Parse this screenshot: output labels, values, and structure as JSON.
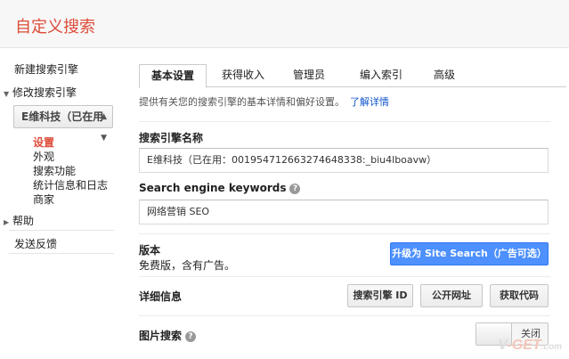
{
  "header": {
    "title": "自定义搜索"
  },
  "sidebar": {
    "new_engine": "新建搜索引擎",
    "edit_engine": "修改搜索引擎",
    "engine_select": "E维科技（已在用",
    "sub_items": [
      "设置",
      "外观",
      "搜索功能",
      "统计信息和日志",
      "商家"
    ],
    "help": "帮助",
    "feedback": "发送反馈"
  },
  "tabs": [
    "基本设置",
    "获得收入",
    "管理员",
    "编入索引",
    "高级"
  ],
  "description": {
    "text": "提供有关您的搜索引擎的基本详情和偏好设置。",
    "link": "了解详情"
  },
  "name_section": {
    "label": "搜索引擎名称",
    "value": "E维科技（已在用：001954712663274648338:_biu4lboavw）"
  },
  "keywords_section": {
    "label": "Search engine keywords",
    "help_icon": "?",
    "value": "网络营销 SEO"
  },
  "edition_section": {
    "label": "版本",
    "note": "免费版，含有广告。",
    "upgrade_button": "升级为 Site Search（广告可选）"
  },
  "details_section": {
    "label": "详细信息",
    "buttons": [
      "搜索引擎 ID",
      "公开网址",
      "获取代码"
    ]
  },
  "image_search": {
    "label": "图片搜索",
    "help_icon": "?",
    "toggle_text": "关闭"
  },
  "watermark": {
    "text_a": "V",
    "text_b": "-GET",
    "text_c": ".com"
  },
  "colors": {
    "brand_red": "#dd4b39",
    "link_blue": "#1155cc",
    "primary_button": "#4d90fe"
  }
}
